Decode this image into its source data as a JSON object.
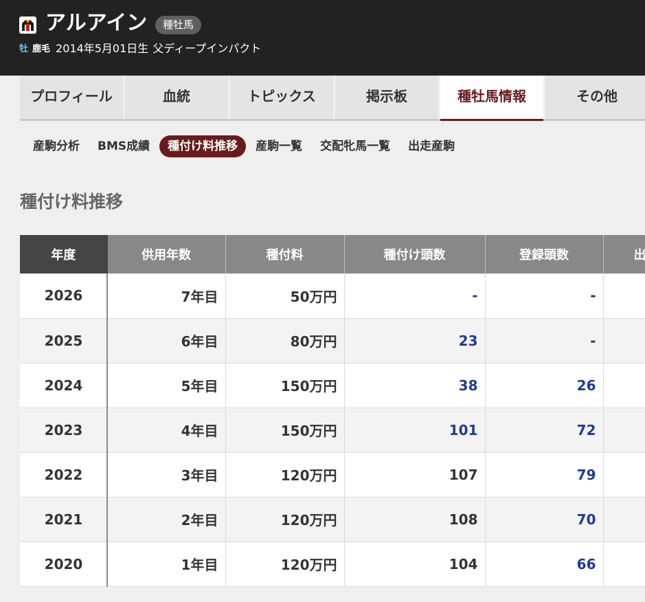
{
  "header": {
    "name": "アルアイン",
    "badge": "種牡馬",
    "sex": "牡",
    "coat": "鹿毛",
    "birth": "2014年5月01日生",
    "sire": "父ディープインパクト"
  },
  "main_tabs": [
    {
      "label": "プロフィール"
    },
    {
      "label": "血統"
    },
    {
      "label": "トピックス"
    },
    {
      "label": "掲示板"
    },
    {
      "label": "種牡馬情報",
      "active": true
    },
    {
      "label": "その他"
    }
  ],
  "sub_tabs": [
    {
      "label": "産駒分析"
    },
    {
      "label": "BMS成績"
    },
    {
      "label": "種付け料推移",
      "active": true
    },
    {
      "label": "産駒一覧"
    },
    {
      "label": "交配牝馬一覧"
    },
    {
      "label": "出走産駒"
    }
  ],
  "section_title": "種付け料推移",
  "table": {
    "headers": [
      "年度",
      "供用年数",
      "種付料",
      "種付け頭数",
      "登録頭数",
      "出"
    ],
    "rows": [
      {
        "year": "2026",
        "service": "7年目",
        "fee": "50万円",
        "covered": "-",
        "registered": "-",
        "covered_link": true,
        "registered_link": false
      },
      {
        "year": "2025",
        "service": "6年目",
        "fee": "80万円",
        "covered": "23",
        "registered": "-",
        "covered_link": true,
        "registered_link": false
      },
      {
        "year": "2024",
        "service": "5年目",
        "fee": "150万円",
        "covered": "38",
        "registered": "26",
        "covered_link": true,
        "registered_link": true
      },
      {
        "year": "2023",
        "service": "4年目",
        "fee": "150万円",
        "covered": "101",
        "registered": "72",
        "covered_link": true,
        "registered_link": true
      },
      {
        "year": "2022",
        "service": "3年目",
        "fee": "120万円",
        "covered": "107",
        "registered": "79",
        "covered_link": false,
        "registered_link": true
      },
      {
        "year": "2021",
        "service": "2年目",
        "fee": "120万円",
        "covered": "108",
        "registered": "70",
        "covered_link": false,
        "registered_link": true
      },
      {
        "year": "2020",
        "service": "1年目",
        "fee": "120万円",
        "covered": "104",
        "registered": "66",
        "covered_link": false,
        "registered_link": true
      }
    ]
  },
  "colors": {
    "accent": "#6a1b1b",
    "link": "#1f3c93",
    "header_bg": "#222222",
    "sex_label": "#5ec9ee"
  },
  "icons": {
    "silk": "jockey-silk-icon"
  }
}
